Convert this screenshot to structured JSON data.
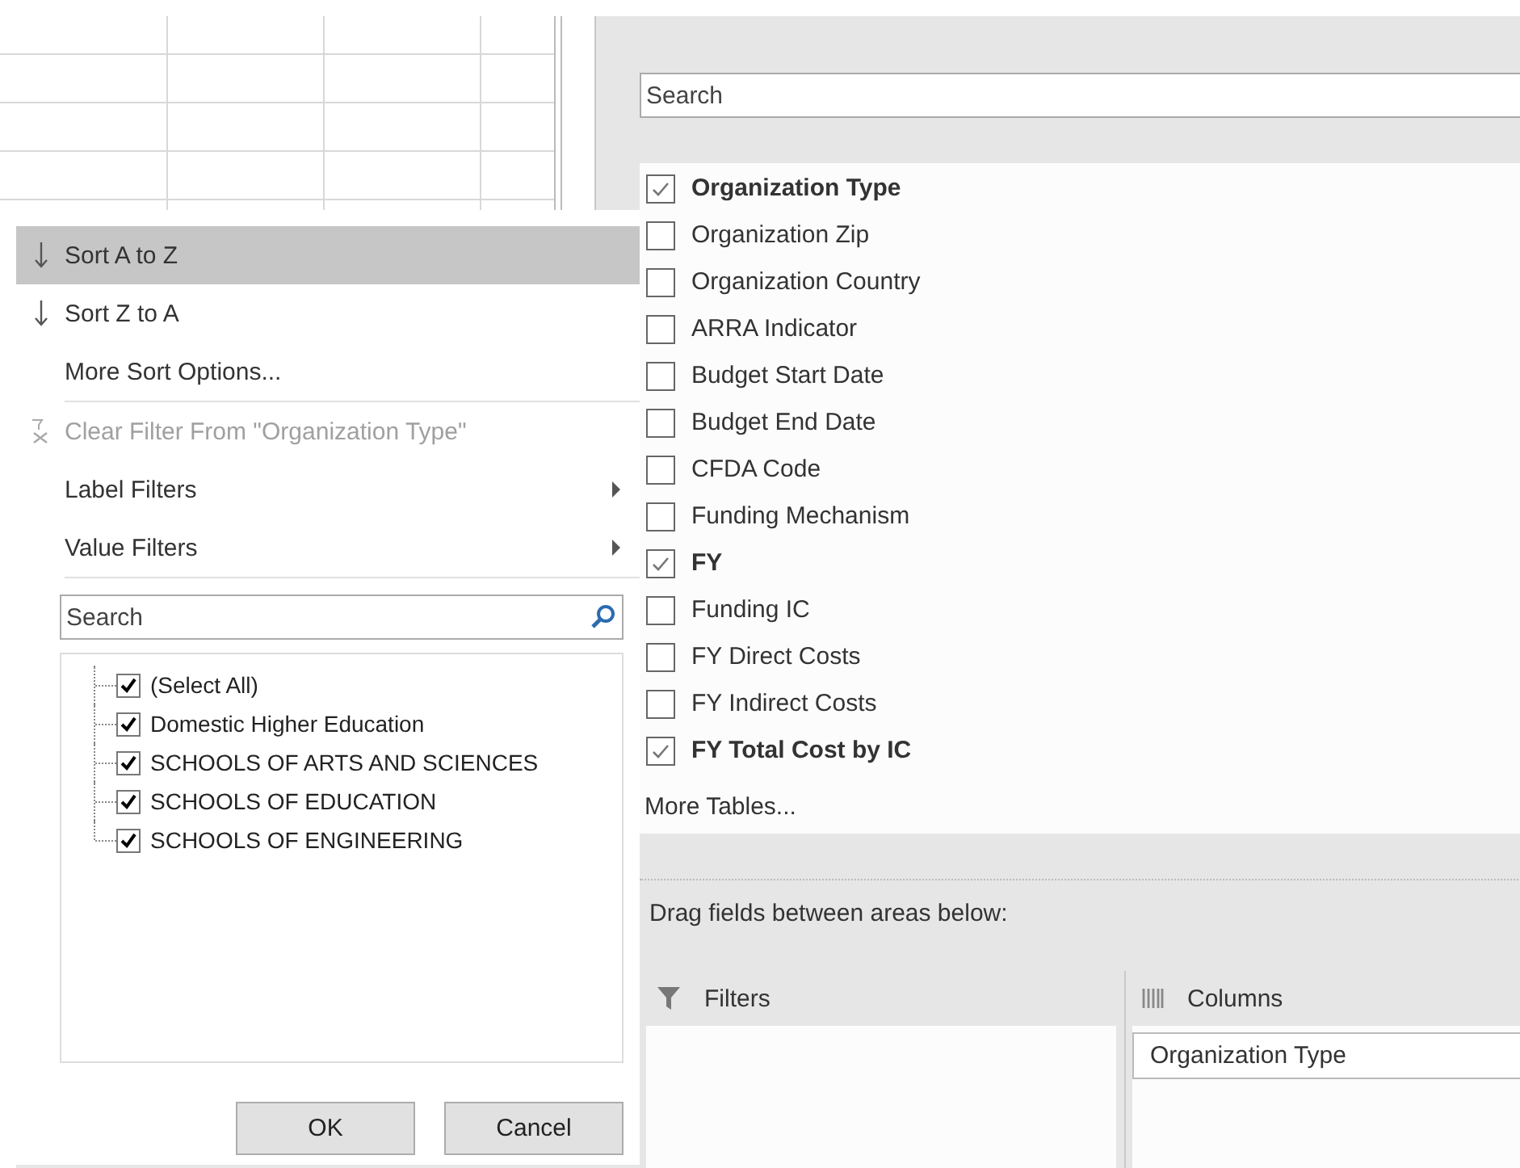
{
  "filter_menu": {
    "items": [
      {
        "kind": "sort_asc",
        "label": "Sort A to Z",
        "selected": true,
        "disabled": false
      },
      {
        "kind": "sort_desc",
        "label": "Sort Z to A",
        "selected": false,
        "disabled": false
      },
      {
        "kind": "plain",
        "label": "More Sort Options...",
        "selected": false,
        "disabled": false
      },
      {
        "kind": "separator"
      },
      {
        "kind": "clear",
        "label": "Clear Filter From \"Organization Type\"",
        "selected": false,
        "disabled": true
      },
      {
        "kind": "submenu",
        "label": "Label Filters",
        "selected": false,
        "disabled": false
      },
      {
        "kind": "submenu",
        "label": "Value Filters",
        "selected": false,
        "disabled": false
      },
      {
        "kind": "separator"
      }
    ],
    "search": {
      "placeholder": "Search"
    },
    "values": [
      {
        "label": "(Select All)",
        "checked": true
      },
      {
        "label": "Domestic Higher Education",
        "checked": true
      },
      {
        "label": "SCHOOLS OF ARTS AND SCIENCES",
        "checked": true
      },
      {
        "label": "SCHOOLS OF EDUCATION",
        "checked": true
      },
      {
        "label": "SCHOOLS OF ENGINEERING",
        "checked": true
      }
    ],
    "buttons": [
      "OK",
      "Cancel"
    ]
  },
  "field_pane": {
    "search": {
      "placeholder": "Search"
    },
    "fields": [
      {
        "label": "Organization Type",
        "checked": true
      },
      {
        "label": "Organization Zip",
        "checked": false
      },
      {
        "label": "Organization Country",
        "checked": false
      },
      {
        "label": "ARRA Indicator",
        "checked": false
      },
      {
        "label": "Budget Start Date",
        "checked": false
      },
      {
        "label": "Budget End Date",
        "checked": false
      },
      {
        "label": "CFDA Code",
        "checked": false
      },
      {
        "label": "Funding Mechanism",
        "checked": false
      },
      {
        "label": "FY",
        "checked": true
      },
      {
        "label": "Funding IC",
        "checked": false
      },
      {
        "label": "FY Direct Costs",
        "checked": false
      },
      {
        "label": "FY Indirect Costs",
        "checked": false
      },
      {
        "label": "FY Total Cost by IC",
        "checked": true
      }
    ],
    "more_tables": "More Tables...",
    "areas_hint": "Drag fields between areas below:",
    "areas": [
      {
        "kind": "filters",
        "title": "Filters"
      },
      {
        "kind": "columns",
        "title": "Columns",
        "items": [
          "Organization Type"
        ]
      }
    ]
  }
}
